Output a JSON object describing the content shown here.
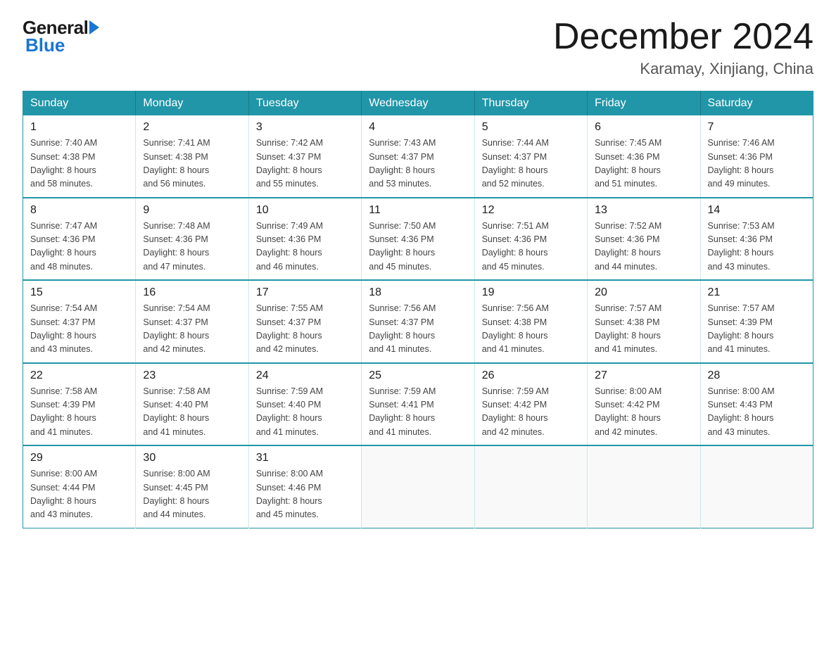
{
  "logo": {
    "general": "General",
    "blue": "Blue"
  },
  "title": "December 2024",
  "location": "Karamay, Xinjiang, China",
  "weekdays": [
    "Sunday",
    "Monday",
    "Tuesday",
    "Wednesday",
    "Thursday",
    "Friday",
    "Saturday"
  ],
  "weeks": [
    [
      {
        "day": "1",
        "sunrise": "7:40 AM",
        "sunset": "4:38 PM",
        "daylight": "8 hours and 58 minutes."
      },
      {
        "day": "2",
        "sunrise": "7:41 AM",
        "sunset": "4:38 PM",
        "daylight": "8 hours and 56 minutes."
      },
      {
        "day": "3",
        "sunrise": "7:42 AM",
        "sunset": "4:37 PM",
        "daylight": "8 hours and 55 minutes."
      },
      {
        "day": "4",
        "sunrise": "7:43 AM",
        "sunset": "4:37 PM",
        "daylight": "8 hours and 53 minutes."
      },
      {
        "day": "5",
        "sunrise": "7:44 AM",
        "sunset": "4:37 PM",
        "daylight": "8 hours and 52 minutes."
      },
      {
        "day": "6",
        "sunrise": "7:45 AM",
        "sunset": "4:36 PM",
        "daylight": "8 hours and 51 minutes."
      },
      {
        "day": "7",
        "sunrise": "7:46 AM",
        "sunset": "4:36 PM",
        "daylight": "8 hours and 49 minutes."
      }
    ],
    [
      {
        "day": "8",
        "sunrise": "7:47 AM",
        "sunset": "4:36 PM",
        "daylight": "8 hours and 48 minutes."
      },
      {
        "day": "9",
        "sunrise": "7:48 AM",
        "sunset": "4:36 PM",
        "daylight": "8 hours and 47 minutes."
      },
      {
        "day": "10",
        "sunrise": "7:49 AM",
        "sunset": "4:36 PM",
        "daylight": "8 hours and 46 minutes."
      },
      {
        "day": "11",
        "sunrise": "7:50 AM",
        "sunset": "4:36 PM",
        "daylight": "8 hours and 45 minutes."
      },
      {
        "day": "12",
        "sunrise": "7:51 AM",
        "sunset": "4:36 PM",
        "daylight": "8 hours and 45 minutes."
      },
      {
        "day": "13",
        "sunrise": "7:52 AM",
        "sunset": "4:36 PM",
        "daylight": "8 hours and 44 minutes."
      },
      {
        "day": "14",
        "sunrise": "7:53 AM",
        "sunset": "4:36 PM",
        "daylight": "8 hours and 43 minutes."
      }
    ],
    [
      {
        "day": "15",
        "sunrise": "7:54 AM",
        "sunset": "4:37 PM",
        "daylight": "8 hours and 43 minutes."
      },
      {
        "day": "16",
        "sunrise": "7:54 AM",
        "sunset": "4:37 PM",
        "daylight": "8 hours and 42 minutes."
      },
      {
        "day": "17",
        "sunrise": "7:55 AM",
        "sunset": "4:37 PM",
        "daylight": "8 hours and 42 minutes."
      },
      {
        "day": "18",
        "sunrise": "7:56 AM",
        "sunset": "4:37 PM",
        "daylight": "8 hours and 41 minutes."
      },
      {
        "day": "19",
        "sunrise": "7:56 AM",
        "sunset": "4:38 PM",
        "daylight": "8 hours and 41 minutes."
      },
      {
        "day": "20",
        "sunrise": "7:57 AM",
        "sunset": "4:38 PM",
        "daylight": "8 hours and 41 minutes."
      },
      {
        "day": "21",
        "sunrise": "7:57 AM",
        "sunset": "4:39 PM",
        "daylight": "8 hours and 41 minutes."
      }
    ],
    [
      {
        "day": "22",
        "sunrise": "7:58 AM",
        "sunset": "4:39 PM",
        "daylight": "8 hours and 41 minutes."
      },
      {
        "day": "23",
        "sunrise": "7:58 AM",
        "sunset": "4:40 PM",
        "daylight": "8 hours and 41 minutes."
      },
      {
        "day": "24",
        "sunrise": "7:59 AM",
        "sunset": "4:40 PM",
        "daylight": "8 hours and 41 minutes."
      },
      {
        "day": "25",
        "sunrise": "7:59 AM",
        "sunset": "4:41 PM",
        "daylight": "8 hours and 41 minutes."
      },
      {
        "day": "26",
        "sunrise": "7:59 AM",
        "sunset": "4:42 PM",
        "daylight": "8 hours and 42 minutes."
      },
      {
        "day": "27",
        "sunrise": "8:00 AM",
        "sunset": "4:42 PM",
        "daylight": "8 hours and 42 minutes."
      },
      {
        "day": "28",
        "sunrise": "8:00 AM",
        "sunset": "4:43 PM",
        "daylight": "8 hours and 43 minutes."
      }
    ],
    [
      {
        "day": "29",
        "sunrise": "8:00 AM",
        "sunset": "4:44 PM",
        "daylight": "8 hours and 43 minutes."
      },
      {
        "day": "30",
        "sunrise": "8:00 AM",
        "sunset": "4:45 PM",
        "daylight": "8 hours and 44 minutes."
      },
      {
        "day": "31",
        "sunrise": "8:00 AM",
        "sunset": "4:46 PM",
        "daylight": "8 hours and 45 minutes."
      },
      null,
      null,
      null,
      null
    ]
  ],
  "labels": {
    "sunrise": "Sunrise:",
    "sunset": "Sunset:",
    "daylight": "Daylight:"
  }
}
